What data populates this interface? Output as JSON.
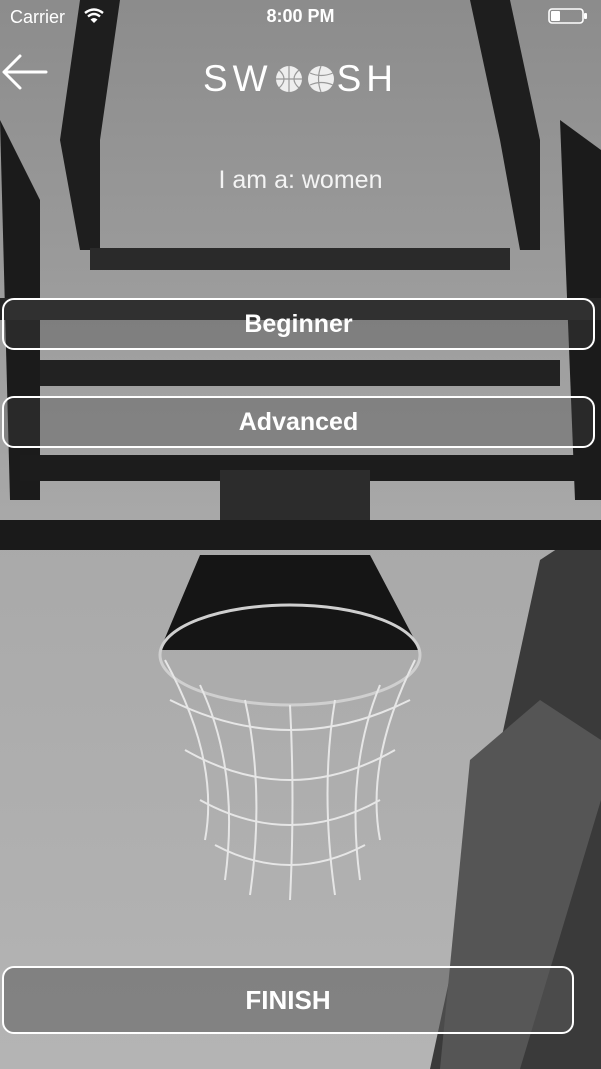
{
  "status_bar": {
    "carrier": "Carrier",
    "time": "8:00 PM"
  },
  "header": {
    "logo_left": "SW",
    "logo_right": "SH",
    "logo_icons": [
      "basketball-icon",
      "volleyball-icon"
    ]
  },
  "gender_line": "I am a: women",
  "levels": [
    {
      "label": "Beginner"
    },
    {
      "label": "Advanced"
    }
  ],
  "finish_label": "FINISH",
  "colors": {
    "text": "#ffffff",
    "border": "#ffffff",
    "background": "#9a9a9a"
  }
}
